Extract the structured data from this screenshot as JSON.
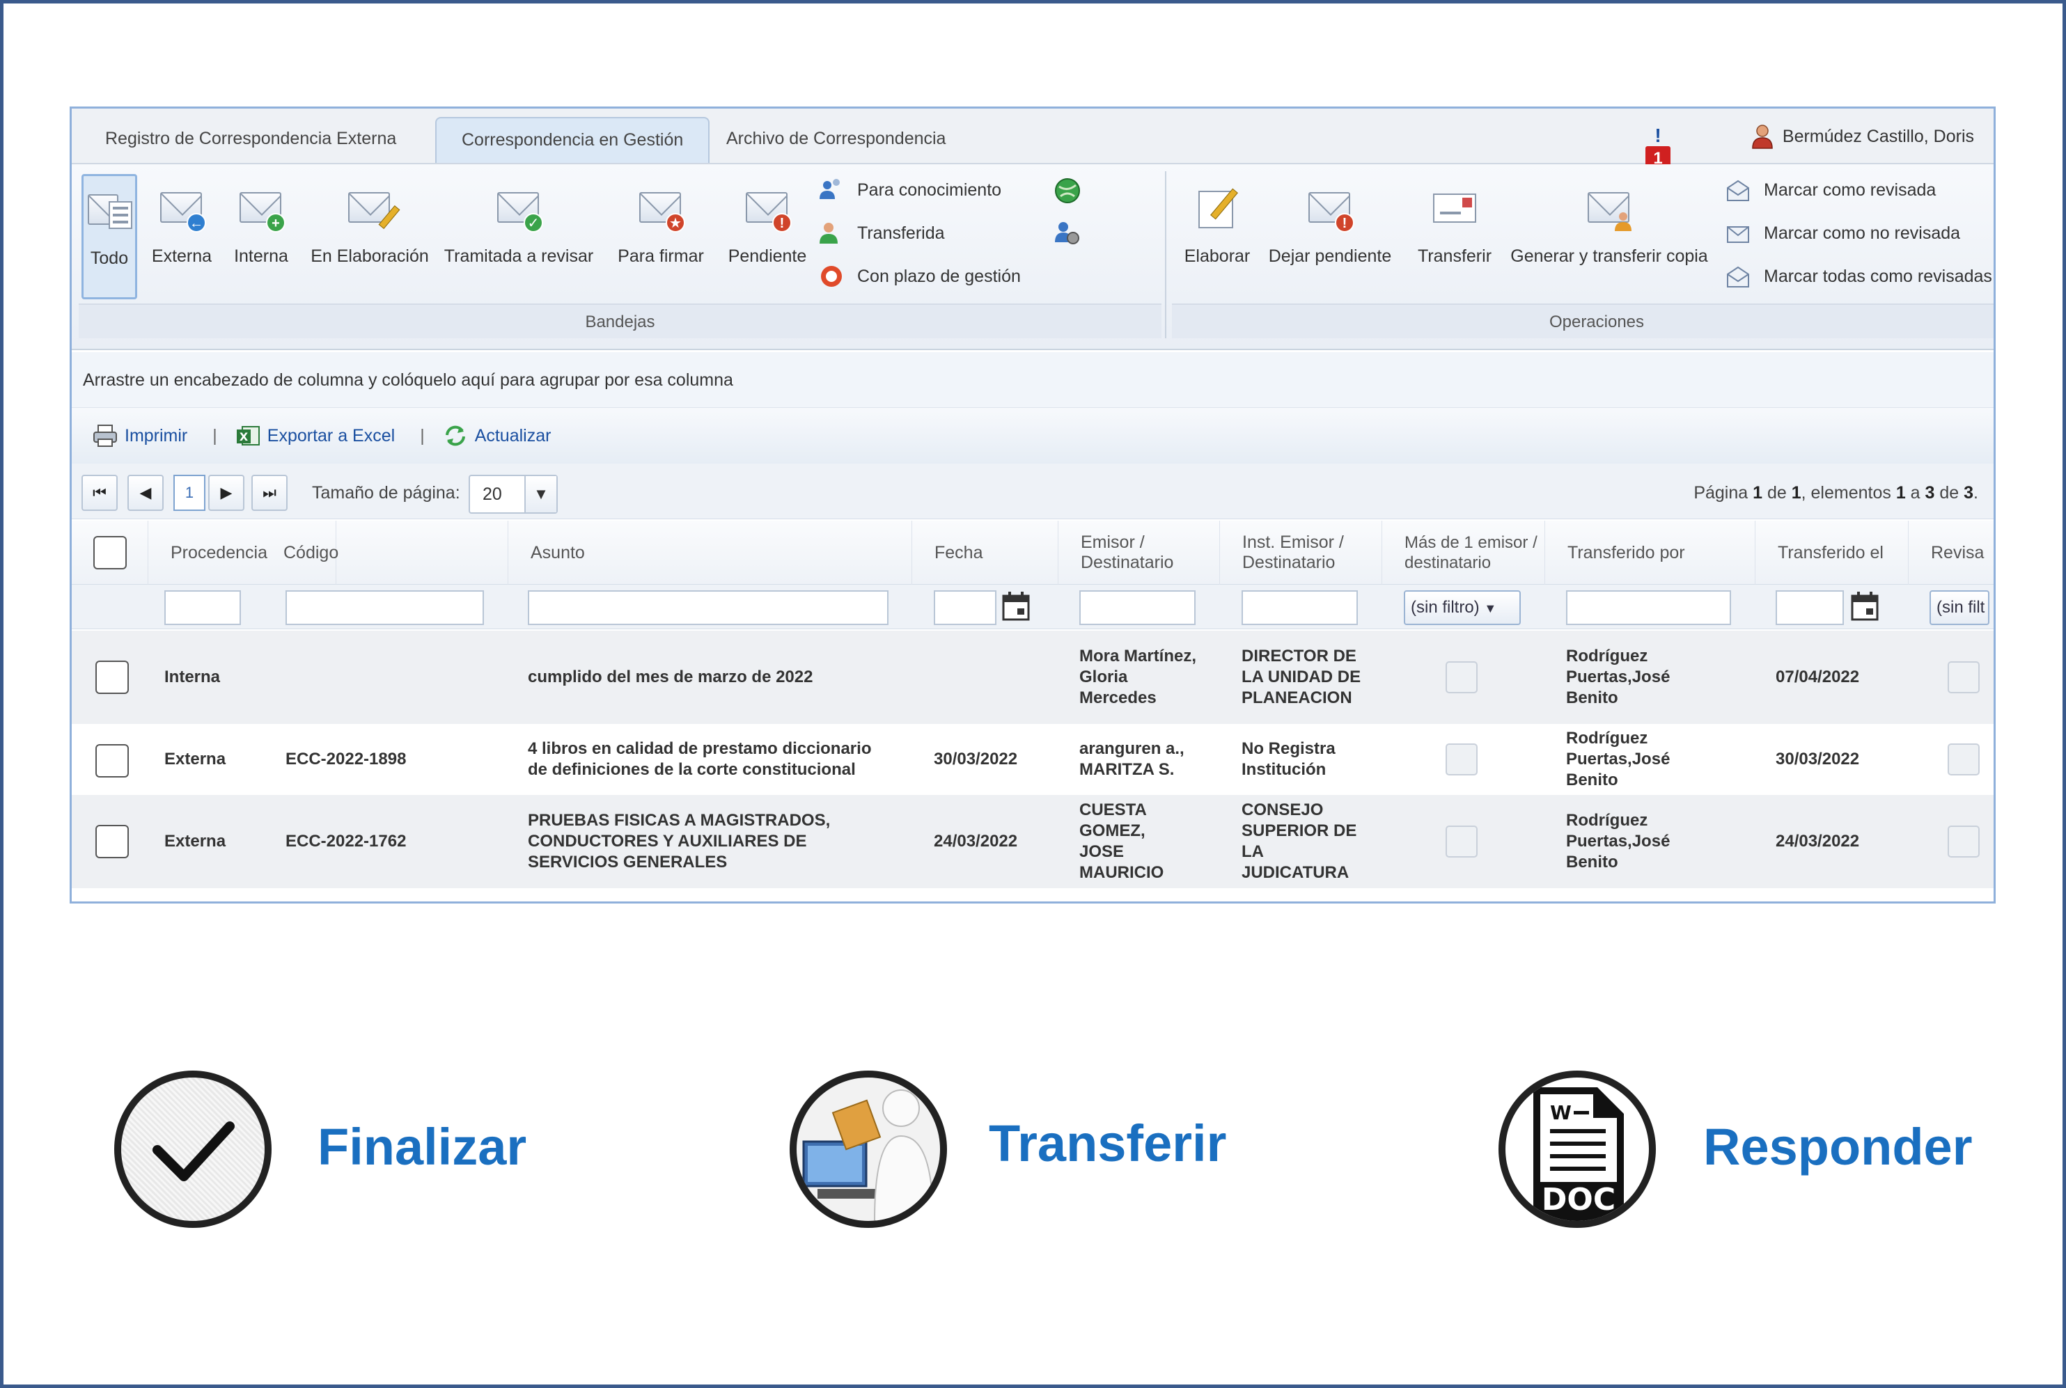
{
  "tabs": [
    {
      "label": "Registro de Correspondencia Externa"
    },
    {
      "label": "Correspondencia en Gestión"
    },
    {
      "label": "Archivo de Correspondencia"
    }
  ],
  "notification_count": "1",
  "user": {
    "name": "Bermúdez Castillo, Doris"
  },
  "ribbon": {
    "bandejas": {
      "label": "Bandejas",
      "buttons": [
        "Todo",
        "Externa",
        "Interna",
        "En Elaboración",
        "Tramitada a revisar",
        "Para firmar",
        "Pendiente"
      ],
      "small": [
        "Para conocimiento",
        "Transferida",
        "Con plazo de gestión"
      ]
    },
    "operaciones": {
      "label": "Operaciones",
      "buttons": [
        "Elaborar",
        "Dejar pendiente",
        "Transferir",
        "Generar y transferir copia"
      ],
      "small": [
        "Marcar como revisada",
        "Marcar como no revisada",
        "Marcar todas como revisadas"
      ]
    }
  },
  "group_hint": "Arrastre un encabezado de columna y colóquelo aquí para agrupar por esa columna",
  "actions": {
    "print": "Imprimir",
    "export": "Exportar a Excel",
    "refresh": "Actualizar",
    "separator": "|"
  },
  "pager": {
    "first": "⏮",
    "prev": "◀",
    "next": "▶",
    "last": "⏭",
    "current_page": "1",
    "page_size_label": "Tamaño de página:",
    "page_size": "20",
    "info_pre": "Página ",
    "page": "1",
    "info_de": " de ",
    "pages": "1",
    "info_elem": ", elementos ",
    "from": "1",
    "info_a": " a ",
    "to": "3",
    "info_de2": " de ",
    "total": "3",
    "info_end": "."
  },
  "columns": {
    "procedencia": "Procedencia",
    "codigo": "Código",
    "asunto": "Asunto",
    "fecha": "Fecha",
    "emisor": "Emisor / Destinatario",
    "inst": "Inst. Emisor / Destinatario",
    "mas": "Más de 1 emisor / destinatario",
    "transferido_por": "Transferido por",
    "transferido_el": "Transferido el",
    "revisada": "Revisa"
  },
  "filters": {
    "sin_filtro": "(sin filtro)",
    "sin_filtro_cut": "(sin filt"
  },
  "rows": [
    {
      "procedencia": "Interna",
      "codigo": "",
      "asunto": "cumplido del mes de marzo de 2022",
      "fecha": "",
      "emisor": "Mora Martínez, Gloria Mercedes",
      "inst": "DIRECTOR DE LA UNIDAD DE PLANEACION",
      "transferido_por": "Rodríguez Puertas,José Benito",
      "transferido_el": "07/04/2022"
    },
    {
      "procedencia": "Externa",
      "codigo": "ECC-2022-1898",
      "asunto": "4 libros en calidad de prestamo diccionario de definiciones de la corte constitucional",
      "fecha": "30/03/2022",
      "emisor": "aranguren a., MARITZA S.",
      "inst": "No Registra Institución",
      "transferido_por": "Rodríguez Puertas,José Benito",
      "transferido_el": "30/03/2022"
    },
    {
      "procedencia": "Externa",
      "codigo": "ECC-2022-1762",
      "asunto": "PRUEBAS FISICAS A MAGISTRADOS, CONDUCTORES Y AUXILIARES DE SERVICIOS GENERALES",
      "fecha": "24/03/2022",
      "emisor": "CUESTA GOMEZ, JOSE MAURICIO",
      "inst": "CONSEJO SUPERIOR DE LA JUDICATURA",
      "transferido_por": "Rodríguez Puertas,José Benito",
      "transferido_el": "24/03/2022"
    }
  ],
  "legend": [
    {
      "label": "Finalizar",
      "icon": "check-icon"
    },
    {
      "label": "Transferir",
      "icon": "transfer-person-icon"
    },
    {
      "label": "Responder",
      "icon": "doc-icon",
      "icon_text": "DOC",
      "icon_letter": "W"
    }
  ],
  "colors": {
    "accent": "#1a6fc0",
    "frame": "#3a5a8c",
    "badge": "#d02020"
  }
}
